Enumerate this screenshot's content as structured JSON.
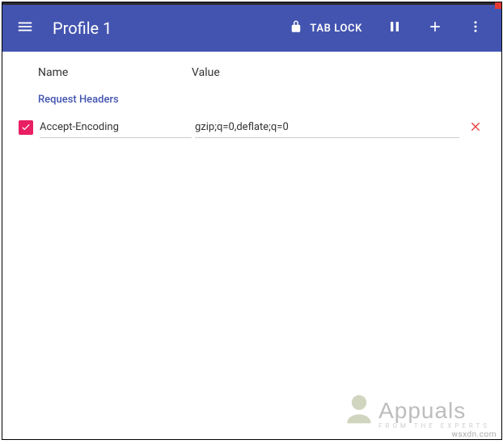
{
  "header": {
    "title": "Profile 1",
    "tab_lock_label": "TAB LOCK"
  },
  "columns": {
    "name_label": "Name",
    "value_label": "Value"
  },
  "section": {
    "label": "Request Headers"
  },
  "row": {
    "name": "Accept-Encoding",
    "value": "gzip;q=0,deflate;q=0",
    "checked": true
  },
  "watermark": {
    "brand": "Appuals",
    "tagline": "FROM THE EXPERTS",
    "url": "wsxdn.com"
  }
}
